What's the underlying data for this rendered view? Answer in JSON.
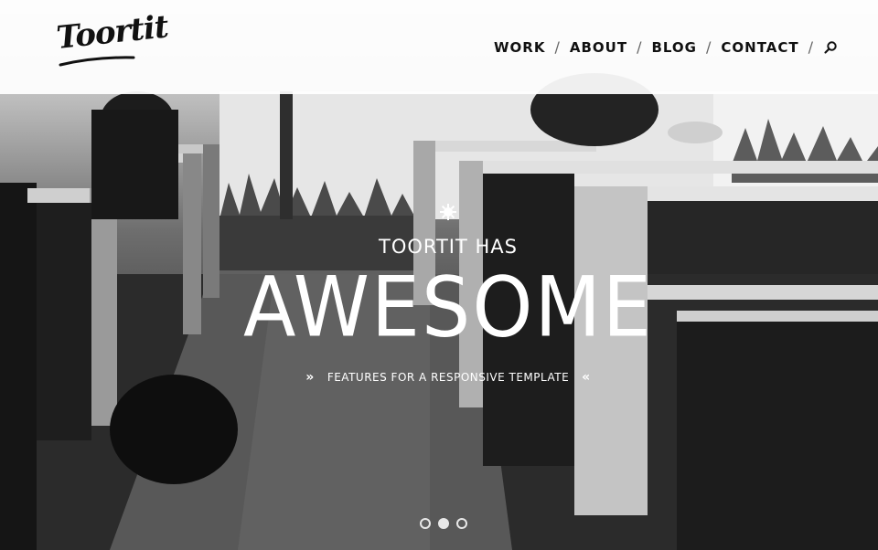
{
  "header": {
    "logo_text": "Toortit",
    "nav": {
      "work": "WORK",
      "about": "ABOUT",
      "blog": "BLOG",
      "contact": "CONTACT",
      "separator": "/",
      "search_icon": "search-icon"
    }
  },
  "hero": {
    "kicker": "TOORTIT HAS",
    "headline": "AWESOME",
    "tagline": "FEATURES FOR A RESPONSIVE TEMPLATE",
    "tagline_left_marker": "»",
    "tagline_right_marker": "«",
    "decor_icon": "sun-icon"
  },
  "slider": {
    "slide_count": 3,
    "active_slide": 2
  },
  "colors": {
    "header_bg": "#ffffff",
    "text_dark": "#111111",
    "hero_text": "#ffffff"
  }
}
